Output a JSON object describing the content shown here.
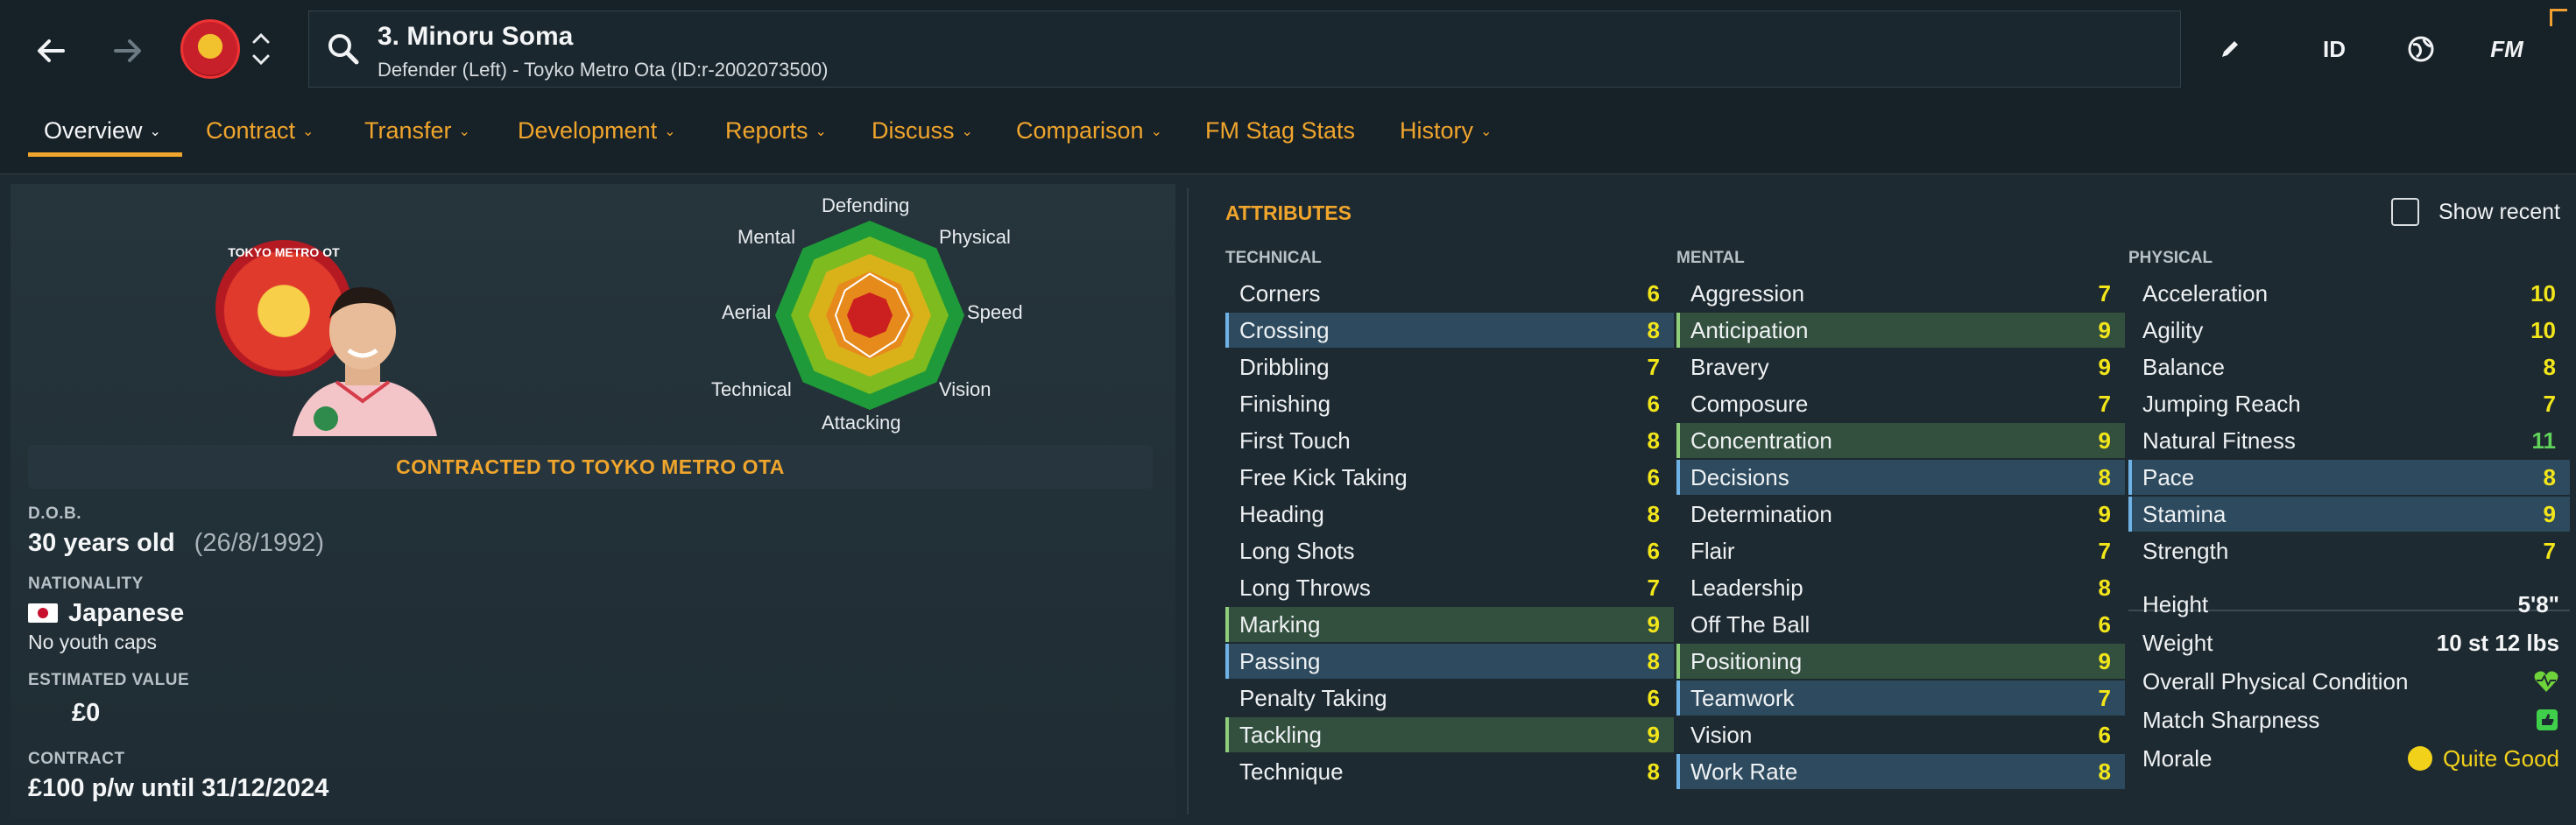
{
  "header": {
    "player_name": "3. Minoru Soma",
    "player_subtitle": "Defender (Left) - Toyko Metro Ota (ID:r-2002073500)",
    "tools": {
      "edit_icon": "pencil-icon",
      "id_label": "ID",
      "globe_icon": "globe-icon",
      "fm_label": "FM"
    }
  },
  "tabs": [
    {
      "label": "Overview",
      "active": true
    },
    {
      "label": "Contract"
    },
    {
      "label": "Transfer"
    },
    {
      "label": "Development"
    },
    {
      "label": "Reports"
    },
    {
      "label": "Discuss"
    },
    {
      "label": "Comparison"
    },
    {
      "label": "FM Stag Stats"
    },
    {
      "label": "History"
    }
  ],
  "profile": {
    "club_logo_text": "TOKYO METRO OT",
    "contracted_banner": "CONTRACTED TO TOYKO METRO OTA",
    "dob_label": "D.O.B.",
    "age": "30 years old",
    "dob": "(26/8/1992)",
    "nationality_label": "NATIONALITY",
    "nationality": "Japanese",
    "youth_caps": "No youth caps",
    "value_label": "ESTIMATED VALUE",
    "value": "£0",
    "contract_label": "CONTRACT",
    "contract": "£100 p/w until 31/12/2024"
  },
  "radar": {
    "labels": {
      "defending": "Defending",
      "physical": "Physical",
      "speed": "Speed",
      "vision": "Vision",
      "attacking": "Attacking",
      "technical": "Technical",
      "aerial": "Aerial",
      "mental": "Mental"
    },
    "colors": [
      "#1e9a3a",
      "#7dbb1f",
      "#d9b21a",
      "#e68a1c",
      "#cc1f1f"
    ]
  },
  "attributes": {
    "title": "ATTRIBUTES",
    "show_recent": "Show recent",
    "technical": {
      "heading": "TECHNICAL",
      "items": [
        {
          "name": "Corners",
          "value": "6",
          "hl": ""
        },
        {
          "name": "Crossing",
          "value": "8",
          "hl": "blue"
        },
        {
          "name": "Dribbling",
          "value": "7",
          "hl": ""
        },
        {
          "name": "Finishing",
          "value": "6",
          "hl": ""
        },
        {
          "name": "First Touch",
          "value": "8",
          "hl": ""
        },
        {
          "name": "Free Kick Taking",
          "value": "6",
          "hl": ""
        },
        {
          "name": "Heading",
          "value": "8",
          "hl": ""
        },
        {
          "name": "Long Shots",
          "value": "6",
          "hl": ""
        },
        {
          "name": "Long Throws",
          "value": "7",
          "hl": ""
        },
        {
          "name": "Marking",
          "value": "9",
          "hl": "green"
        },
        {
          "name": "Passing",
          "value": "8",
          "hl": "blue"
        },
        {
          "name": "Penalty Taking",
          "value": "6",
          "hl": ""
        },
        {
          "name": "Tackling",
          "value": "9",
          "hl": "green"
        },
        {
          "name": "Technique",
          "value": "8",
          "hl": ""
        }
      ]
    },
    "mental": {
      "heading": "MENTAL",
      "items": [
        {
          "name": "Aggression",
          "value": "7",
          "hl": ""
        },
        {
          "name": "Anticipation",
          "value": "9",
          "hl": "green"
        },
        {
          "name": "Bravery",
          "value": "9",
          "hl": ""
        },
        {
          "name": "Composure",
          "value": "7",
          "hl": ""
        },
        {
          "name": "Concentration",
          "value": "9",
          "hl": "green"
        },
        {
          "name": "Decisions",
          "value": "8",
          "hl": "blue"
        },
        {
          "name": "Determination",
          "value": "9",
          "hl": ""
        },
        {
          "name": "Flair",
          "value": "7",
          "hl": ""
        },
        {
          "name": "Leadership",
          "value": "8",
          "hl": ""
        },
        {
          "name": "Off The Ball",
          "value": "6",
          "hl": ""
        },
        {
          "name": "Positioning",
          "value": "9",
          "hl": "green"
        },
        {
          "name": "Teamwork",
          "value": "7",
          "hl": "blue"
        },
        {
          "name": "Vision",
          "value": "6",
          "hl": ""
        },
        {
          "name": "Work Rate",
          "value": "8",
          "hl": "blue"
        }
      ]
    },
    "physical": {
      "heading": "PHYSICAL",
      "items": [
        {
          "name": "Acceleration",
          "value": "10",
          "hl": ""
        },
        {
          "name": "Agility",
          "value": "10",
          "hl": ""
        },
        {
          "name": "Balance",
          "value": "8",
          "hl": ""
        },
        {
          "name": "Jumping Reach",
          "value": "7",
          "hl": ""
        },
        {
          "name": "Natural Fitness",
          "value": "11",
          "hl": "",
          "green": true
        },
        {
          "name": "Pace",
          "value": "8",
          "hl": "blue"
        },
        {
          "name": "Stamina",
          "value": "9",
          "hl": "blue"
        },
        {
          "name": "Strength",
          "value": "7",
          "hl": ""
        }
      ]
    },
    "info": {
      "height_label": "Height",
      "height": "5'8\"",
      "weight_label": "Weight",
      "weight": "10 st 12 lbs",
      "condition_label": "Overall Physical Condition",
      "condition_icon": "heart-icon",
      "sharpness_label": "Match Sharpness",
      "sharpness_icon": "thumbs-up-icon",
      "morale_label": "Morale",
      "morale": "Quite Good"
    }
  }
}
